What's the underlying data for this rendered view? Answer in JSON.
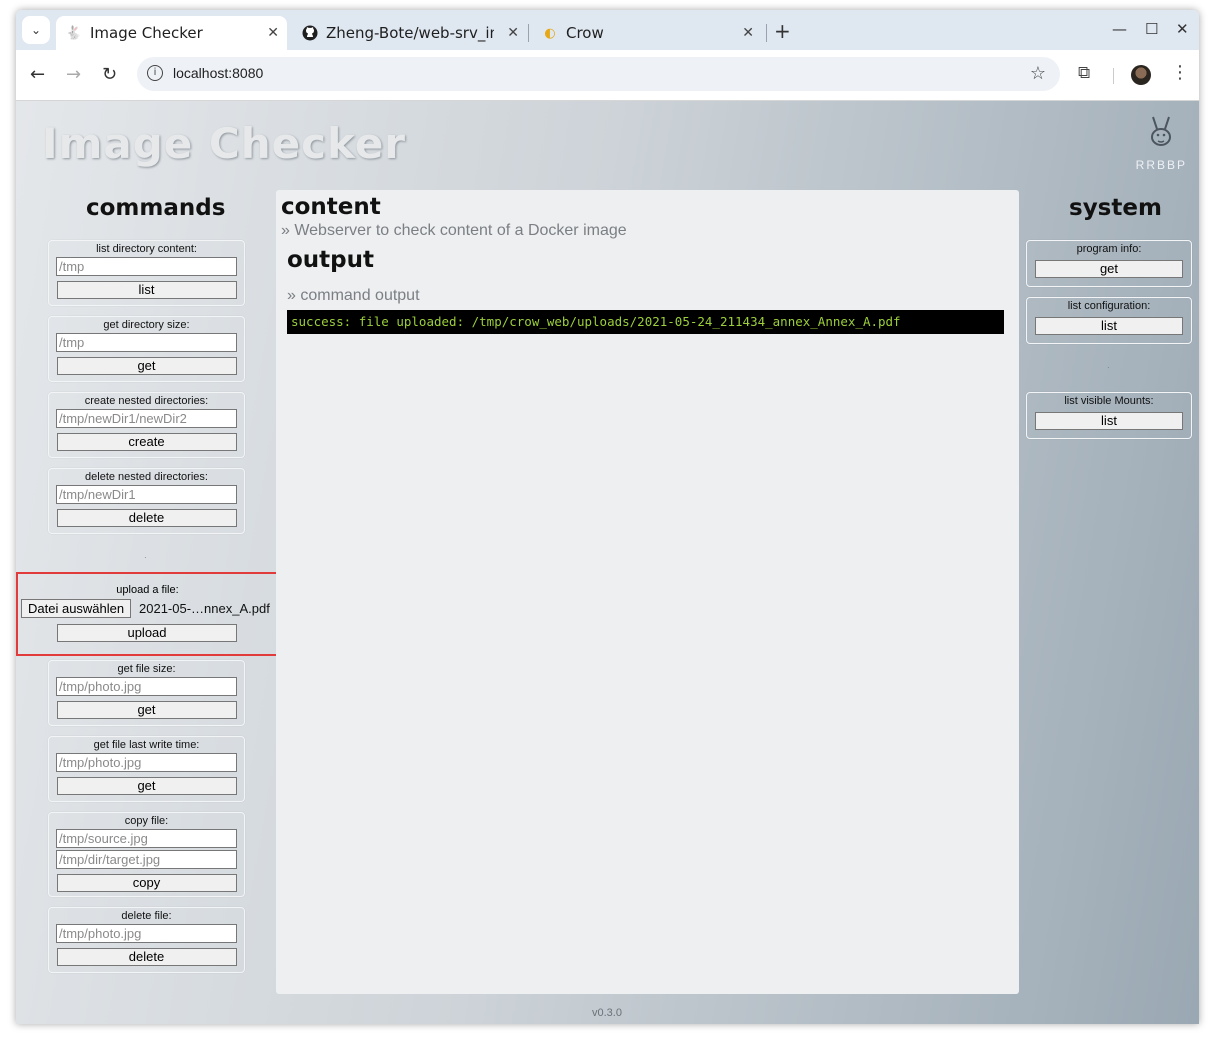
{
  "browser": {
    "tabs": [
      {
        "title": "Image Checker",
        "icon": "rabbit-icon",
        "active": true
      },
      {
        "title": "Zheng-Bote/web-srv_im",
        "icon": "github-icon",
        "active": false
      },
      {
        "title": "Crow",
        "icon": "crow-icon",
        "active": false
      }
    ],
    "url": "localhost:8080"
  },
  "header": {
    "title": "Image Checker",
    "logo_text": "RRBBP"
  },
  "commands": {
    "heading": "commands",
    "cards": [
      {
        "label": "list directory content:",
        "inputs": [
          "/tmp"
        ],
        "button": "list"
      },
      {
        "label": "get directory size:",
        "inputs": [
          "/tmp"
        ],
        "button": "get"
      },
      {
        "label": "create nested directories:",
        "inputs": [
          "/tmp/newDir1/newDir2"
        ],
        "button": "create"
      },
      {
        "label": "delete nested directories:",
        "inputs": [
          "/tmp/newDir1"
        ],
        "button": "delete"
      }
    ],
    "upload": {
      "label": "upload a file:",
      "file_button": "Datei auswählen",
      "file_name": "2021-05-…nnex_A.pdf",
      "button": "upload"
    },
    "cards2": [
      {
        "label": "get file size:",
        "inputs": [
          "/tmp/photo.jpg"
        ],
        "button": "get"
      },
      {
        "label": "get file last write time:",
        "inputs": [
          "/tmp/photo.jpg"
        ],
        "button": "get"
      },
      {
        "label": "copy file:",
        "inputs": [
          "/tmp/source.jpg",
          "/tmp/dir/target.jpg"
        ],
        "button": "copy"
      },
      {
        "label": "delete file:",
        "inputs": [
          "/tmp/photo.jpg"
        ],
        "button": "delete"
      }
    ]
  },
  "content": {
    "heading": "content",
    "subtitle": "» Webserver to check content of a Docker image",
    "output_heading": "output",
    "output_subtitle": "» command output",
    "output_text": "success: file uploaded: /tmp/crow_web/uploads/2021-05-24_211434_annex_Annex_A.pdf"
  },
  "system": {
    "heading": "system",
    "cards": [
      {
        "label": "program info:",
        "button": "get"
      },
      {
        "label": "list configuration:",
        "button": "list"
      },
      {
        "label": "list visible Mounts:",
        "button": "list"
      }
    ]
  },
  "footer": {
    "version": "v0.3.0"
  },
  "colors": {
    "console_bg": "#000000",
    "console_text": "#9ccf3a",
    "highlight": "#e23b3b"
  }
}
